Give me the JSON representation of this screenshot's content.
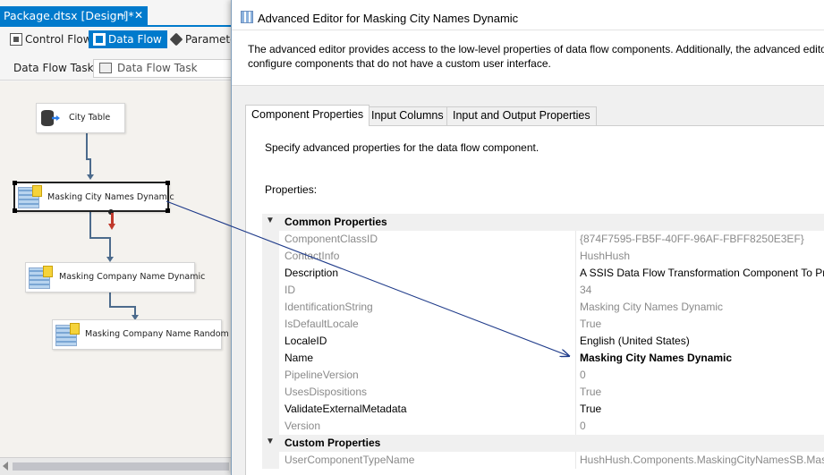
{
  "designer": {
    "doc_tab": {
      "title": "Package.dtsx [Design]*",
      "pin_glyph": "⊣",
      "close_glyph": "✕"
    },
    "tabs": [
      {
        "label": "Control Flow",
        "icon": "control-flow-icon"
      },
      {
        "label": "Data Flow",
        "icon": "data-flow-icon"
      },
      {
        "label": "Parameters",
        "icon": "parameters-icon"
      }
    ],
    "task_label": "Data Flow Task:",
    "task_value": "Data Flow Task",
    "nodes": [
      {
        "label": "City Table",
        "icon": "database-source-icon"
      },
      {
        "label": "Masking City Names Dynamic",
        "icon": "masking-component-icon"
      },
      {
        "label": "Masking Company Name Dynamic",
        "icon": "masking-component-icon"
      },
      {
        "label": "Masking Company Name Random",
        "icon": "masking-component-icon"
      }
    ]
  },
  "dialog": {
    "title": "Advanced Editor for Masking City Names Dynamic",
    "header_line1": "The advanced editor provides access to the low-level properties of data flow components. Additionally, the advanced editor can",
    "header_line2": "configure components that do not have a custom user interface.",
    "tabs": [
      "Component Properties",
      "Input Columns",
      "Input and Output Properties"
    ],
    "active_tab": "Component Properties",
    "panel_description": "Specify advanced properties for the data flow component.",
    "properties_label": "Properties:",
    "categories": [
      {
        "label": "Common Properties",
        "toggle": "▼",
        "rows": [
          {
            "name": "ComponentClassID",
            "value": "{874F7595-FB5F-40FF-96AF-FBFF8250E3EF}",
            "readonly": true
          },
          {
            "name": "ContactInfo",
            "value": "HushHush",
            "readonly": true
          },
          {
            "name": "Description",
            "value": "A SSIS Data Flow Transformation Component To Process Data Masking",
            "readonly": false
          },
          {
            "name": "ID",
            "value": "34",
            "readonly": true
          },
          {
            "name": "IdentificationString",
            "value": "Masking City Names Dynamic",
            "readonly": true
          },
          {
            "name": "IsDefaultLocale",
            "value": "True",
            "readonly": true
          },
          {
            "name": "LocaleID",
            "value": "English (United States)",
            "readonly": false
          },
          {
            "name": "Name",
            "value": "Masking City Names Dynamic",
            "readonly": false,
            "bold_value": true
          },
          {
            "name": "PipelineVersion",
            "value": "0",
            "readonly": true
          },
          {
            "name": "UsesDispositions",
            "value": "True",
            "readonly": true
          },
          {
            "name": "ValidateExternalMetadata",
            "value": "True",
            "readonly": false
          },
          {
            "name": "Version",
            "value": "0",
            "readonly": true
          }
        ]
      },
      {
        "label": "Custom Properties",
        "toggle": "▼",
        "rows": [
          {
            "name": "UserComponentTypeName",
            "value": "HushHush.Components.MaskingCityNamesSB.MaskingCityNamesSB",
            "readonly": true
          }
        ]
      }
    ]
  }
}
